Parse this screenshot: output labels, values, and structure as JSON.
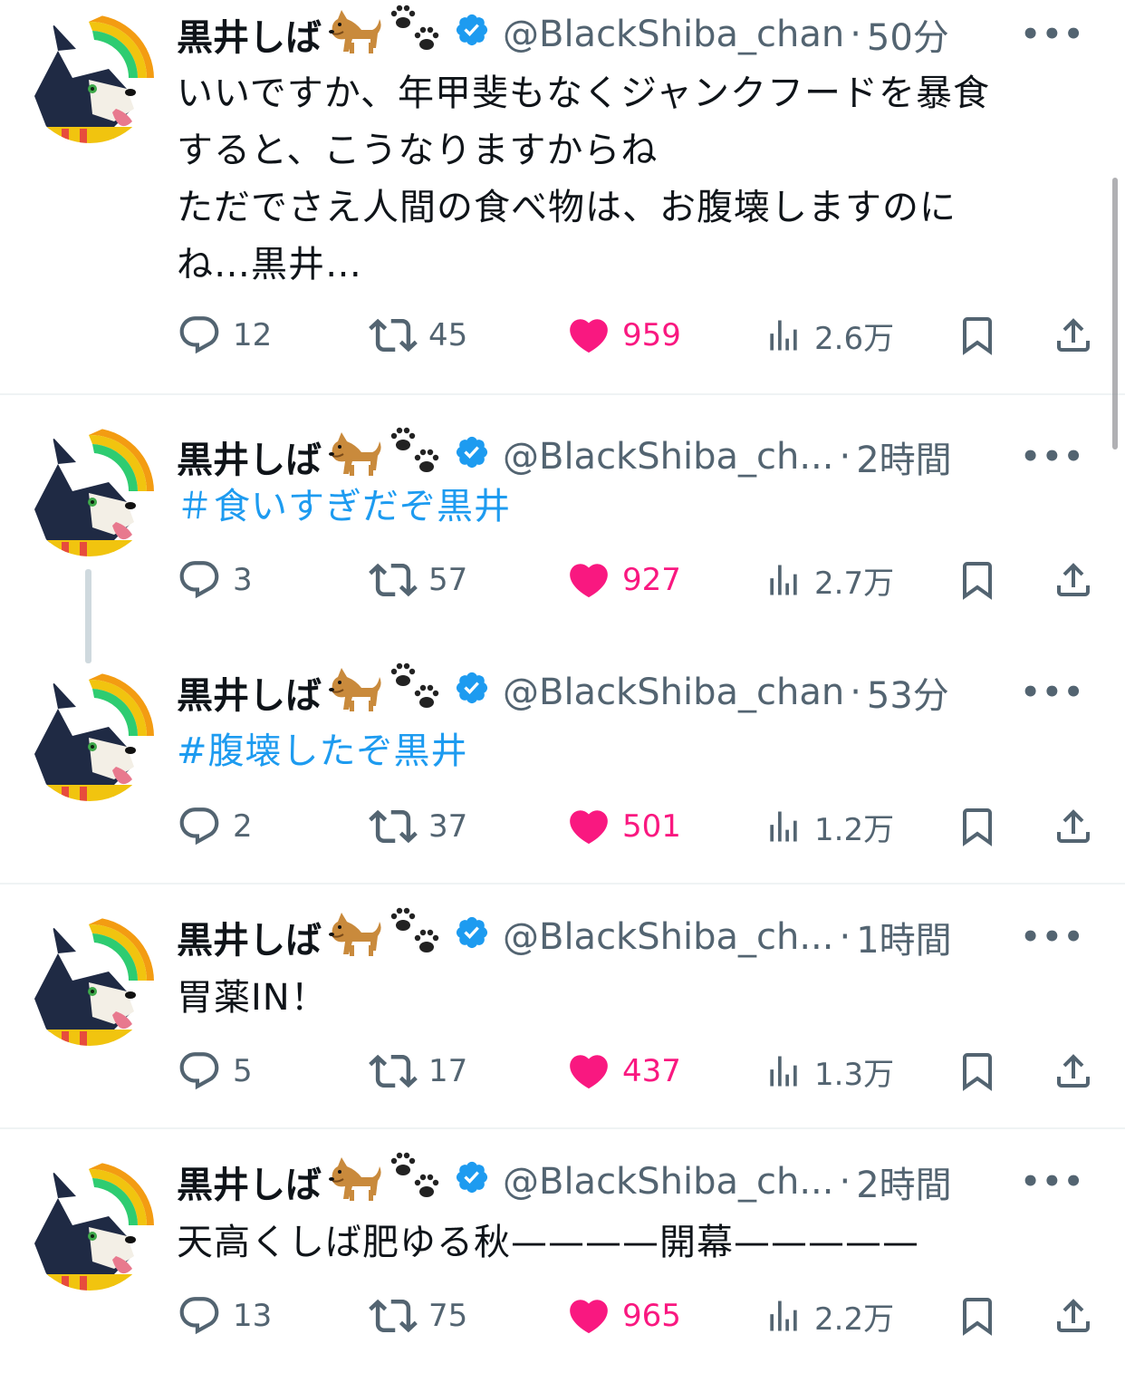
{
  "author": {
    "name": "黒井しば",
    "handle": "@BlackShiba_chan",
    "handle_short": "@BlackShiba_ch...",
    "verified": true
  },
  "colors": {
    "like": "#f91880",
    "link": "#1d9bf0",
    "muted": "#536471",
    "verified": "#1d9bf0"
  },
  "tweets": [
    {
      "handle": "@BlackShiba_chan",
      "time": "50分",
      "text": "いいですか、年甲斐もなくジャンクフードを暴食\nすると、こうなりますからね\nただでさえ人間の食べ物は、お腹壊しますのに\nね…黒井…",
      "replies": "12",
      "retweets": "45",
      "likes": "959",
      "views": "2.6万"
    },
    {
      "handle": "@BlackShiba_ch...",
      "time": "2時間",
      "text": "＃食いすぎだぞ黒井",
      "replies": "3",
      "retweets": "57",
      "likes": "927",
      "views": "2.7万"
    },
    {
      "handle": "@BlackShiba_chan",
      "time": "53分",
      "text": "#腹壊したぞ黒井",
      "replies": "2",
      "retweets": "37",
      "likes": "501",
      "views": "1.2万"
    },
    {
      "handle": "@BlackShiba_ch...",
      "time": "1時間",
      "text": "胃薬IN！",
      "replies": "5",
      "retweets": "17",
      "likes": "437",
      "views": "1.3万"
    },
    {
      "handle": "@BlackShiba_ch...",
      "time": "2時間",
      "text": "天高くしば肥ゆる秋————開幕—————",
      "replies": "13",
      "retweets": "75",
      "likes": "965",
      "views": "2.2万"
    }
  ],
  "icons": {
    "reply": "reply-icon",
    "retweet": "retweet-icon",
    "like": "heart-icon",
    "views": "views-icon",
    "bookmark": "bookmark-icon",
    "share": "share-icon",
    "more": "more-icon",
    "verified": "verified-badge-icon",
    "dog": "dog-emoji-icon",
    "paws": "paw-prints-icon"
  }
}
